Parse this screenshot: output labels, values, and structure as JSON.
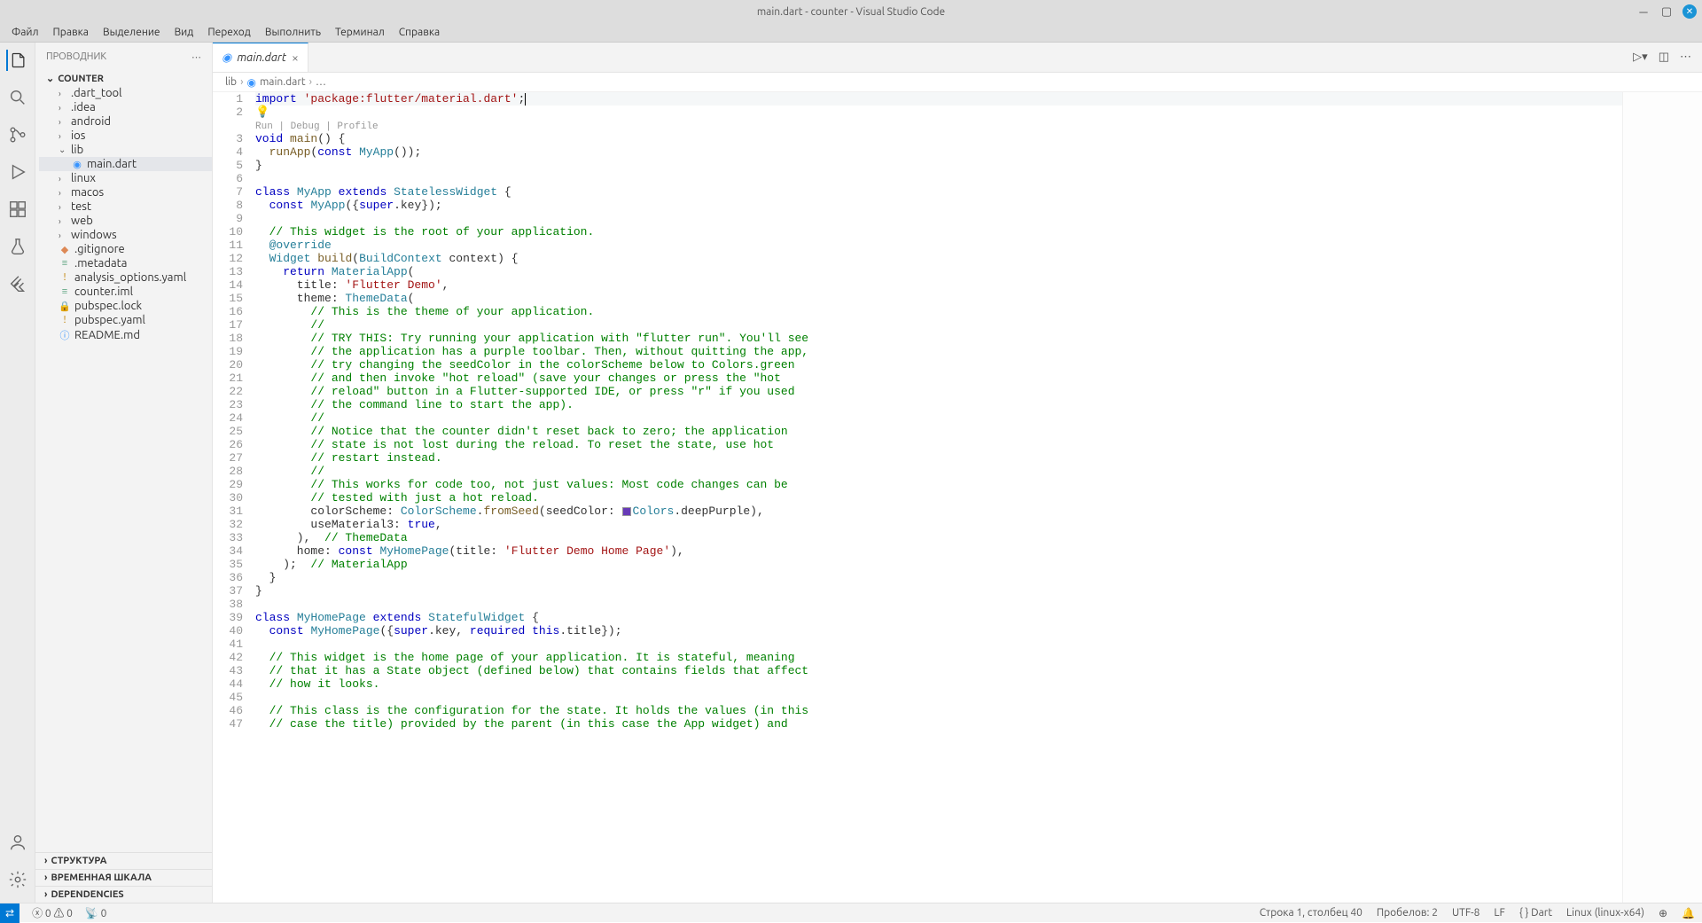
{
  "title": "main.dart - counter - Visual Studio Code",
  "menu": [
    "Файл",
    "Правка",
    "Выделение",
    "Вид",
    "Переход",
    "Выполнить",
    "Терминал",
    "Справка"
  ],
  "sidebar": {
    "title": "ПРОВОДНИК",
    "root": "COUNTER",
    "items": [
      {
        "label": ".dart_tool",
        "type": "folder"
      },
      {
        "label": ".idea",
        "type": "folder"
      },
      {
        "label": "android",
        "type": "folder"
      },
      {
        "label": "ios",
        "type": "folder"
      },
      {
        "label": "lib",
        "type": "folder",
        "open": true
      },
      {
        "label": "main.dart",
        "type": "dart",
        "depth": 2,
        "selected": true
      },
      {
        "label": "linux",
        "type": "folder"
      },
      {
        "label": "macos",
        "type": "folder"
      },
      {
        "label": "test",
        "type": "folder"
      },
      {
        "label": "web",
        "type": "folder"
      },
      {
        "label": "windows",
        "type": "folder"
      },
      {
        "label": ".gitignore",
        "type": "git"
      },
      {
        "label": ".metadata",
        "type": "file"
      },
      {
        "label": "analysis_options.yaml",
        "type": "yaml"
      },
      {
        "label": "counter.iml",
        "type": "file"
      },
      {
        "label": "pubspec.lock",
        "type": "lock"
      },
      {
        "label": "pubspec.yaml",
        "type": "yaml"
      },
      {
        "label": "README.md",
        "type": "md"
      }
    ],
    "collapsed": [
      "СТРУКТУРА",
      "ВРЕМЕННАЯ ШКАЛА",
      "DEPENDENCIES"
    ]
  },
  "tab": {
    "label": "main.dart"
  },
  "breadcrumb": [
    "lib",
    "main.dart",
    "…"
  ],
  "codelens": "Run | Debug | Profile",
  "status": {
    "errors": "0",
    "warnings": "0",
    "ports": "0",
    "pos": "Строка 1, столбец 40",
    "spaces": "Пробелов: 2",
    "enc": "UTF-8",
    "eol": "LF",
    "lang": "{ } Dart",
    "os": "Linux (linux-x64)"
  },
  "code": [
    {
      "n": 1,
      "html": "<span class='kw'>import</span> <span class='str'>'package:flutter/material.dart'</span>;<span class='cursor'></span>",
      "hl": true
    },
    {
      "n": 2,
      "html": "<span class='bulb'>💡</span>"
    },
    {
      "n": "",
      "html": "<span class='codelens'>Run | Debug | Profile</span>"
    },
    {
      "n": 3,
      "html": "<span class='kw'>void</span> <span class='fn'>main</span>() {"
    },
    {
      "n": 4,
      "html": "  <span class='fn'>runApp</span>(<span class='kw'>const</span> <span class='typ'>MyApp</span>());"
    },
    {
      "n": 5,
      "html": "}"
    },
    {
      "n": 6,
      "html": ""
    },
    {
      "n": 7,
      "html": "<span class='kw'>class</span> <span class='typ'>MyApp</span> <span class='kw'>extends</span> <span class='typ'>StatelessWidget</span> {"
    },
    {
      "n": 8,
      "html": "  <span class='kw'>const</span> <span class='typ'>MyApp</span>({<span class='kw'>super</span>.key});"
    },
    {
      "n": 9,
      "html": ""
    },
    {
      "n": 10,
      "html": "  <span class='cmt'>// This widget is the root of your application.</span>"
    },
    {
      "n": 11,
      "html": "  <span class='ann'>@override</span>"
    },
    {
      "n": 12,
      "html": "  <span class='typ'>Widget</span> <span class='fn'>build</span>(<span class='typ'>BuildContext</span> context) {"
    },
    {
      "n": 13,
      "html": "    <span class='kw'>return</span> <span class='typ'>MaterialApp</span>("
    },
    {
      "n": 14,
      "html": "      title: <span class='str'>'Flutter Demo'</span>,"
    },
    {
      "n": 15,
      "html": "      theme: <span class='typ'>ThemeData</span>("
    },
    {
      "n": 16,
      "html": "        <span class='cmt'>// This is the theme of your application.</span>"
    },
    {
      "n": 17,
      "html": "        <span class='cmt'>//</span>"
    },
    {
      "n": 18,
      "html": "        <span class='cmt'>// TRY THIS: Try running your application with \"flutter run\". You'll see</span>"
    },
    {
      "n": 19,
      "html": "        <span class='cmt'>// the application has a purple toolbar. Then, without quitting the app,</span>"
    },
    {
      "n": 20,
      "html": "        <span class='cmt'>// try changing the seedColor in the colorScheme below to Colors.green</span>"
    },
    {
      "n": 21,
      "html": "        <span class='cmt'>// and then invoke \"hot reload\" (save your changes or press the \"hot</span>"
    },
    {
      "n": 22,
      "html": "        <span class='cmt'>// reload\" button in a Flutter-supported IDE, or press \"r\" if you used</span>"
    },
    {
      "n": 23,
      "html": "        <span class='cmt'>// the command line to start the app).</span>"
    },
    {
      "n": 24,
      "html": "        <span class='cmt'>//</span>"
    },
    {
      "n": 25,
      "html": "        <span class='cmt'>// Notice that the counter didn't reset back to zero; the application</span>"
    },
    {
      "n": 26,
      "html": "        <span class='cmt'>// state is not lost during the reload. To reset the state, use hot</span>"
    },
    {
      "n": 27,
      "html": "        <span class='cmt'>// restart instead.</span>"
    },
    {
      "n": 28,
      "html": "        <span class='cmt'>//</span>"
    },
    {
      "n": 29,
      "html": "        <span class='cmt'>// This works for code too, not just values: Most code changes can be</span>"
    },
    {
      "n": 30,
      "html": "        <span class='cmt'>// tested with just a hot reload.</span>"
    },
    {
      "n": 31,
      "html": "        colorScheme: <span class='typ'>ColorScheme</span>.<span class='fn'>fromSeed</span>(seedColor: <span class='colorchip'></span><span class='typ'>Colors</span>.deepPurple),"
    },
    {
      "n": 32,
      "html": "        useMaterial3: <span class='kw'>true</span>,"
    },
    {
      "n": 33,
      "html": "      ), <span class='cmt'> // ThemeData</span>"
    },
    {
      "n": 34,
      "html": "      home: <span class='kw'>const</span> <span class='typ'>MyHomePage</span>(title: <span class='str'>'Flutter Demo Home Page'</span>),"
    },
    {
      "n": 35,
      "html": "    ); <span class='cmt'> // MaterialApp</span>"
    },
    {
      "n": 36,
      "html": "  }"
    },
    {
      "n": 37,
      "html": "}"
    },
    {
      "n": 38,
      "html": ""
    },
    {
      "n": 39,
      "html": "<span class='kw'>class</span> <span class='typ'>MyHomePage</span> <span class='kw'>extends</span> <span class='typ'>StatefulWidget</span> {"
    },
    {
      "n": 40,
      "html": "  <span class='kw'>const</span> <span class='typ'>MyHomePage</span>({<span class='kw'>super</span>.key, <span class='kw'>required this</span>.title});"
    },
    {
      "n": 41,
      "html": ""
    },
    {
      "n": 42,
      "html": "  <span class='cmt'>// This widget is the home page of your application. It is stateful, meaning</span>"
    },
    {
      "n": 43,
      "html": "  <span class='cmt'>// that it has a State object (defined below) that contains fields that affect</span>"
    },
    {
      "n": 44,
      "html": "  <span class='cmt'>// how it looks.</span>"
    },
    {
      "n": 45,
      "html": ""
    },
    {
      "n": 46,
      "html": "  <span class='cmt'>// This class is the configuration for the state. It holds the values (in this</span>"
    },
    {
      "n": 47,
      "html": "  <span class='cmt'>// case the title) provided by the parent (in this case the App widget) and</span>"
    }
  ]
}
